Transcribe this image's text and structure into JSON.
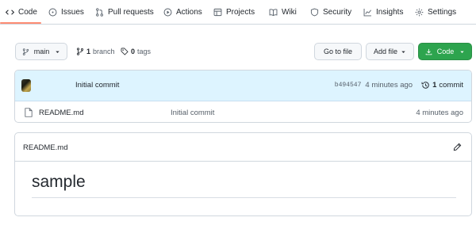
{
  "tabs": [
    {
      "label": "Code",
      "icon": "code-icon",
      "active": true
    },
    {
      "label": "Issues",
      "icon": "issue-icon"
    },
    {
      "label": "Pull requests",
      "icon": "pull-request-icon"
    },
    {
      "label": "Actions",
      "icon": "play-icon"
    },
    {
      "label": "Projects",
      "icon": "table-icon"
    },
    {
      "label": "Wiki",
      "icon": "book-icon"
    },
    {
      "label": "Security",
      "icon": "shield-icon"
    },
    {
      "label": "Insights",
      "icon": "graph-icon"
    },
    {
      "label": "Settings",
      "icon": "gear-icon"
    }
  ],
  "toolbar": {
    "branch_label": "main",
    "branch_count": "1",
    "branch_text": "branch",
    "tag_count": "0",
    "tag_text": "tags",
    "go_to_file": "Go to file",
    "add_file": "Add file",
    "code": "Code"
  },
  "latest_commit": {
    "message": "Initial commit",
    "sha": "b494547",
    "age": "4 minutes ago",
    "count": "1",
    "count_label": "commit"
  },
  "files": [
    {
      "name": "README.md",
      "commit": "Initial commit",
      "age": "4 minutes ago"
    }
  ],
  "readme": {
    "filename": "README.md",
    "heading": "sample"
  },
  "colors": {
    "accent_underline": "#fd8c73",
    "primary_button": "#2da44e",
    "commit_row_bg": "#ddf4ff"
  }
}
